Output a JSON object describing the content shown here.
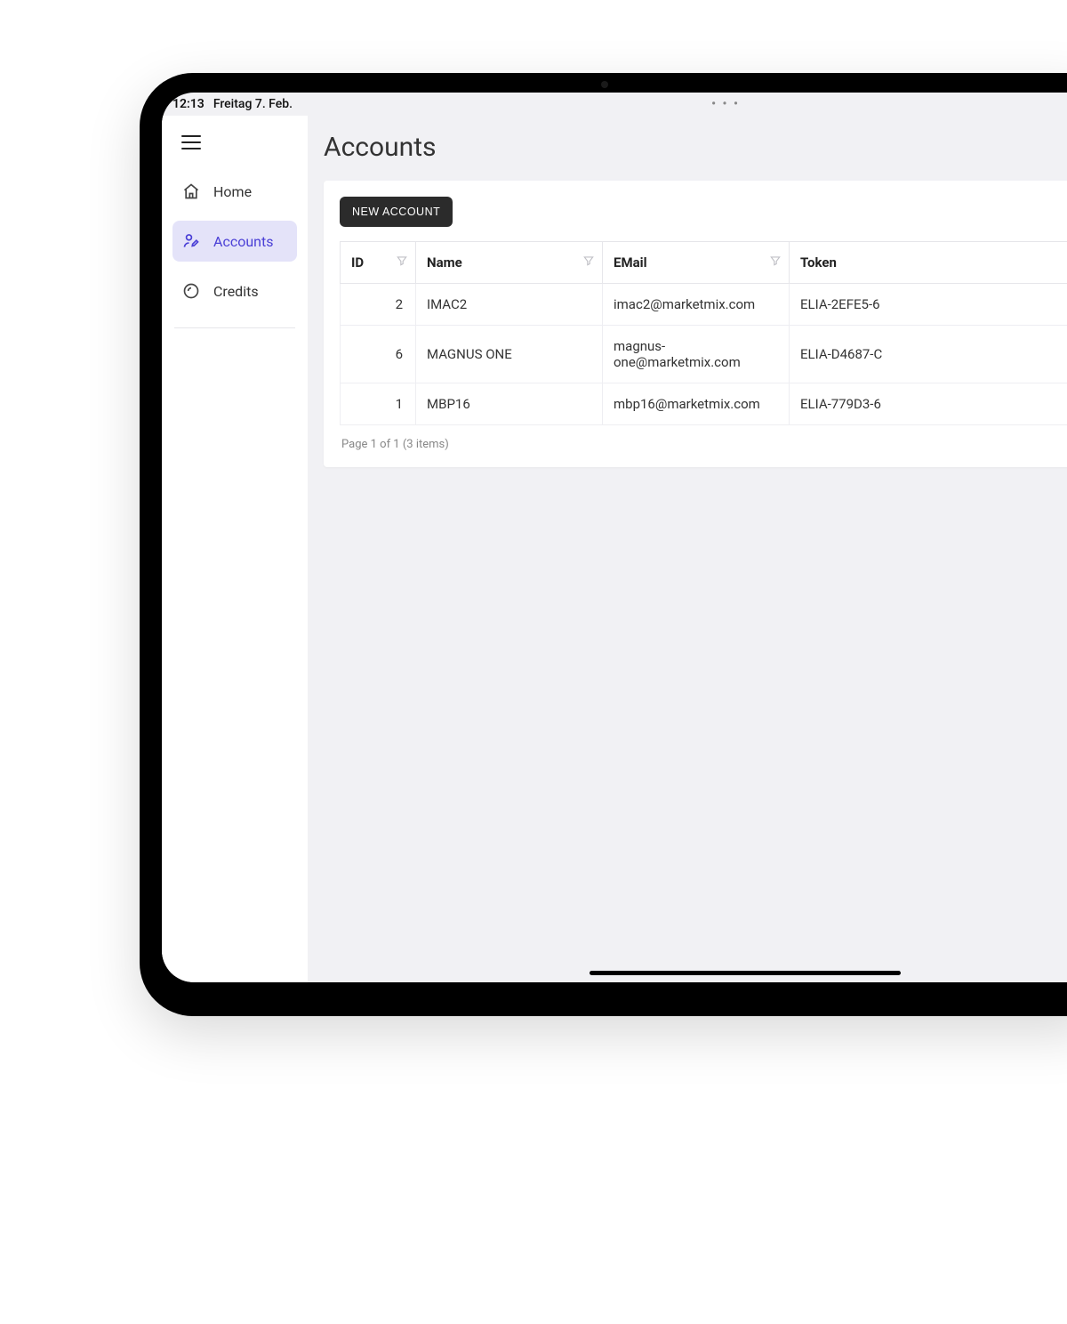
{
  "status": {
    "time": "12:13",
    "date": "Freitag 7. Feb.",
    "dots": "• • •"
  },
  "sidebar": {
    "items": [
      {
        "label": "Home",
        "icon": "home",
        "active": false
      },
      {
        "label": "Accounts",
        "icon": "person-edit",
        "active": true
      },
      {
        "label": "Credits",
        "icon": "coin",
        "active": false
      }
    ]
  },
  "main": {
    "title": "Accounts",
    "new_button": "NEW ACCOUNT",
    "columns": [
      "ID",
      "Name",
      "EMail",
      "Token"
    ],
    "rows": [
      {
        "id": "2",
        "name": "IMAC2",
        "email": "imac2@marketmix.com",
        "token": "ELIA-2EFE5-6"
      },
      {
        "id": "6",
        "name": "MAGNUS ONE",
        "email": "magnus-one@marketmix.com",
        "token": "ELIA-D4687-C"
      },
      {
        "id": "1",
        "name": "MBP16",
        "email": "mbp16@marketmix.com",
        "token": "ELIA-779D3-6"
      }
    ],
    "pager": "Page 1 of 1 (3 items)"
  }
}
